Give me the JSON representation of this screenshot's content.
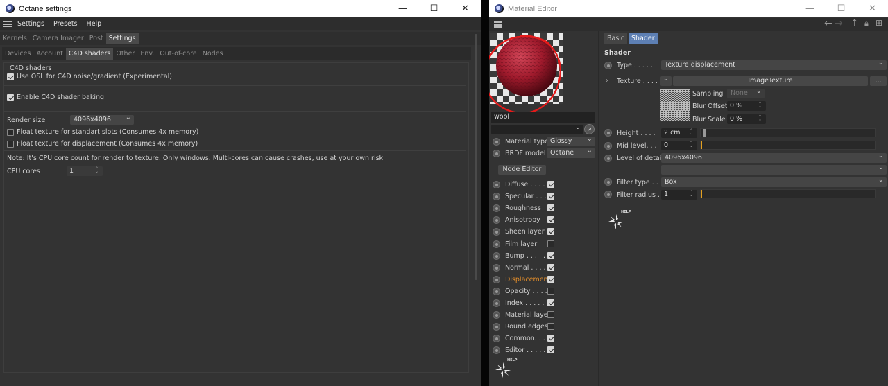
{
  "octane": {
    "title": "Octane settings",
    "menu": [
      "Settings",
      "Presets",
      "Help"
    ],
    "tabs1": [
      "Kernels",
      "Camera Imager",
      "Post",
      "Settings"
    ],
    "tabs2": [
      "Devices",
      "Account",
      "C4D shaders",
      "Other",
      "Env.",
      "Out-of-core",
      "Nodes"
    ],
    "section_title": "C4D shaders",
    "use_osl": "Use OSL for C4D noise/gradient (Experimental)",
    "enable_baking": "Enable C4D shader baking",
    "render_size_label": "Render size",
    "render_size_value": "4096x4096",
    "float_standard": "Float texture for standart slots (Consumes 4x memory)",
    "float_displacement": "Float texture for displacement (Consumes 4x memory)",
    "note": "Note: It's CPU core count for render to texture. Only windows. Multi-cores can cause crashes, use at your own risk.",
    "cpu_cores_label": "CPU cores",
    "cpu_cores_value": "1"
  },
  "mated": {
    "title": "Material Editor",
    "material_name": "wool",
    "material_type_label": "Material type",
    "material_type_value": "Glossy",
    "brdf_label": "BRDF model",
    "brdf_value": "Octane",
    "node_editor": "Node Editor",
    "channels": [
      {
        "label": "Diffuse . . . .",
        "checked": true
      },
      {
        "label": "Specular . . .",
        "checked": true
      },
      {
        "label": "Roughness",
        "checked": true
      },
      {
        "label": "Anisotropy",
        "checked": true
      },
      {
        "label": "Sheen layer",
        "checked": true
      },
      {
        "label": "Film layer",
        "checked": false
      },
      {
        "label": "Bump . . . . .",
        "checked": true
      },
      {
        "label": "Normal . . . .",
        "checked": true
      },
      {
        "label": "Displacement",
        "checked": true,
        "active": true
      },
      {
        "label": "Opacity . . . .",
        "checked": false
      },
      {
        "label": "Index . . . . .",
        "checked": true
      },
      {
        "label": "Material layer",
        "checked": false
      },
      {
        "label": "Round edges",
        "checked": false
      },
      {
        "label": "Common. . . .",
        "checked": true
      },
      {
        "label": "Editor . . . . .",
        "checked": true
      }
    ],
    "tab_basic": "Basic",
    "tab_shader": "Shader",
    "shader_heading": "Shader",
    "type_label": "Type . . . . . .",
    "type_value": "Texture displacement",
    "texture_label": "Texture . . . .",
    "texture_button": "ImageTexture",
    "texture_more": "...",
    "sampling_label": "Sampling",
    "sampling_value": "None",
    "blur_offset_label": "Blur Offset",
    "blur_offset_value": "0 %",
    "blur_scale_label": "Blur Scale",
    "blur_scale_value": "0 %",
    "height_label": "Height . . . .",
    "height_value": "2 cm",
    "height_fraction": 0.02,
    "mid_level_label": "Mid level. . .",
    "mid_level_value": "0",
    "lod_label": "Level of detail",
    "lod_value": "4096x4096",
    "filter_type_label": "Filter type . .",
    "filter_type_value": "Box",
    "filter_radius_label": "Filter radius .",
    "filter_radius_value": "1.",
    "help_label": "HELP",
    "accent": "#e8902a"
  }
}
